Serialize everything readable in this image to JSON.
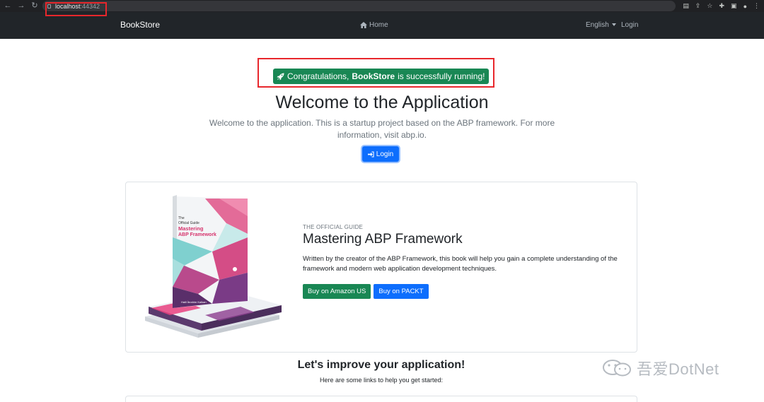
{
  "browser": {
    "url_host": "localhost",
    "url_port": ":44342"
  },
  "navbar": {
    "brand": "BookStore",
    "home": "Home",
    "language": "English",
    "login": "Login"
  },
  "hero": {
    "badge_prefix": "Congratulations,",
    "badge_app": "BookStore",
    "badge_suffix": "is successfully running!",
    "title": "Welcome to the Application",
    "text": "Welcome to the application. This is a startup project based on the ABP framework. For more information, visit abp.io.",
    "login_button": "Login"
  },
  "book": {
    "eyebrow": "THE OFFICIAL GUIDE",
    "title": "Mastering ABP Framework",
    "description": "Written by the creator of the ABP Framework, this book will help you gain a complete understanding of the framework and modern web application development techniques.",
    "amazon_button": "Buy on Amazon US",
    "packt_button": "Buy on PACKT",
    "cover_lines": [
      "The",
      "Official Guide",
      "Mastering",
      "ABP Framework"
    ],
    "cover_author": "Halil İbrahim Kalkan"
  },
  "improve": {
    "title": "Let's improve your application!",
    "subtitle": "Here are some links to help you get started:"
  },
  "watermark": {
    "text": "吾爱DotNet"
  },
  "colors": {
    "success": "#198754",
    "primary": "#0d6efd",
    "navbar": "#212529",
    "annotation": "#e8272c"
  }
}
